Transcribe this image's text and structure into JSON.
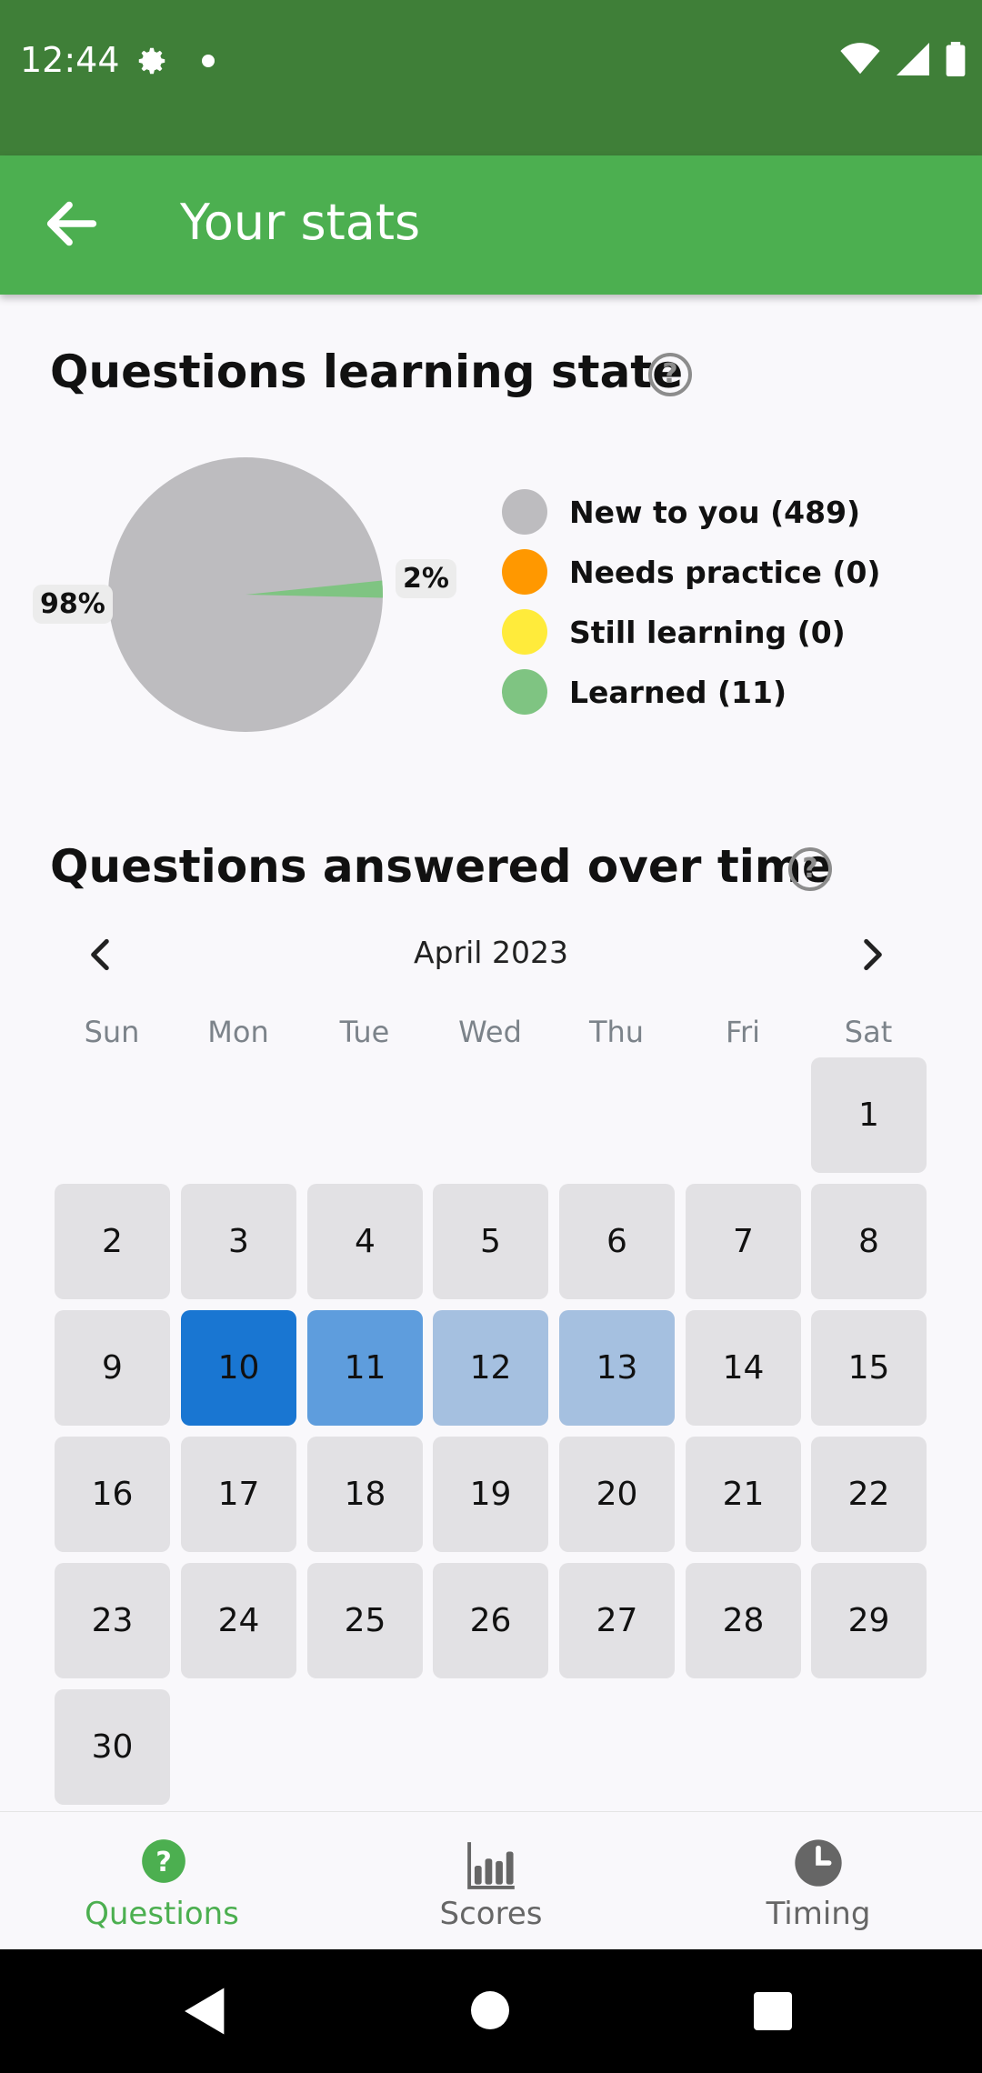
{
  "status_bar": {
    "time": "12:44"
  },
  "app_bar": {
    "title": "Your stats"
  },
  "learning_state": {
    "title": "Questions learning state",
    "chart_data": {
      "type": "pie",
      "slices": [
        {
          "label": "New to you",
          "count": 489,
          "percent": 98,
          "color": "#bdbcbf"
        },
        {
          "label": "Needs practice",
          "count": 0,
          "percent": 0,
          "color": "#ff9800"
        },
        {
          "label": "Still learning",
          "count": 0,
          "percent": 0,
          "color": "#ffeb3b"
        },
        {
          "label": "Learned",
          "count": 11,
          "percent": 2,
          "color": "#7fc482"
        }
      ],
      "data_labels": [
        "98%",
        "2%"
      ]
    },
    "legend": [
      {
        "label": "New to you (489)",
        "color": "#bdbcbf"
      },
      {
        "label": "Needs practice (0)",
        "color": "#ff9800"
      },
      {
        "label": "Still learning (0)",
        "color": "#ffeb3b"
      },
      {
        "label": "Learned (11)",
        "color": "#7fc482"
      }
    ]
  },
  "answered_over_time": {
    "title": "Questions answered over time",
    "month": "April 2023",
    "weekdays": [
      "Sun",
      "Mon",
      "Tue",
      "Wed",
      "Thu",
      "Fri",
      "Sat"
    ],
    "first_weekday_index": 6,
    "days_in_month": 30,
    "highlight": {
      "10": "#1976d2",
      "11": "#5e9ddd",
      "12": "#a5c0e0",
      "13": "#a5c0e0"
    }
  },
  "bottom_nav": {
    "items": [
      {
        "label": "Questions",
        "icon": "question-circle-icon",
        "active": true
      },
      {
        "label": "Scores",
        "icon": "bar-chart-icon",
        "active": false
      },
      {
        "label": "Timing",
        "icon": "clock-icon",
        "active": false
      }
    ]
  },
  "colors": {
    "accent": "#4caf50",
    "status_bar": "#3f7f38"
  }
}
